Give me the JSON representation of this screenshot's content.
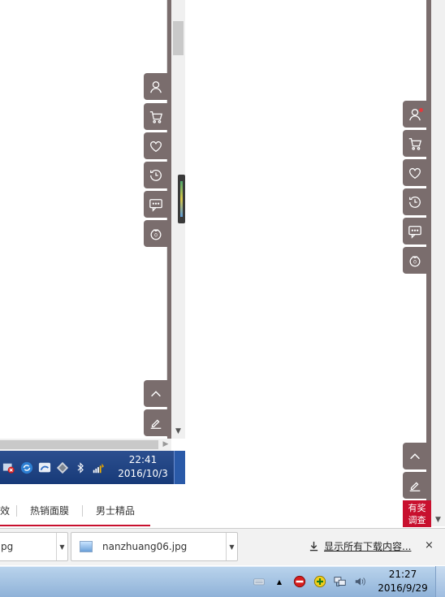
{
  "inner_window": {
    "taskbar": {
      "time": "22:41",
      "date": "2016/10/3"
    },
    "side_toolbar": [
      "user-icon",
      "cart-icon",
      "heart-icon",
      "history-icon",
      "chat-icon",
      "service-icon"
    ],
    "bottom_toolbar": [
      "back-to-top-icon",
      "feedback-edit-icon"
    ]
  },
  "right_window": {
    "side_toolbar": [
      "user-icon",
      "cart-icon",
      "heart-icon",
      "history-icon",
      "chat-icon",
      "service-icon"
    ],
    "bottom_toolbar": [
      "back-to-top-icon",
      "feedback-edit-icon"
    ],
    "survey_label_line1": "有奖",
    "survey_label_line2": "调查"
  },
  "category_tabs": [
    "效",
    "热销面膜",
    "男士精品"
  ],
  "download_bar": {
    "items": [
      {
        "name": "pg"
      },
      {
        "name": "nanzhuang06.jpg"
      }
    ],
    "show_all_label": "显示所有下载内容...",
    "close_label": "×"
  },
  "taskbar": {
    "time": "21:27",
    "date": "2016/9/29"
  },
  "colors": {
    "toolbar_brown": "#7a6d6d",
    "accent_red": "#c8102e",
    "inner_taskbar_blue": "#173a78",
    "outer_taskbar_blue": "#a3c2e2"
  }
}
